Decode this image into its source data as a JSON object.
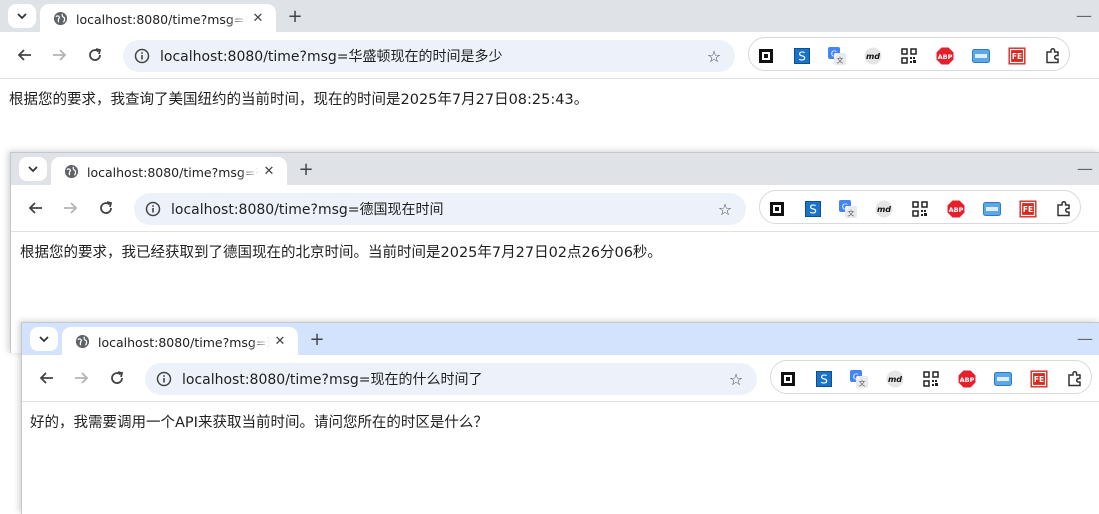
{
  "windows": [
    {
      "tab": {
        "title": "localhost:8080/time?msg=华盛顿现在的时间是多少"
      },
      "omnibox": {
        "host": "localhost",
        "rest": ":8080/time?msg=华盛顿现在的时间是多少"
      },
      "content": "根据您的要求，我查询了美国纽约的当前时间，现在的时间是2025年7月27日08:25:43。"
    },
    {
      "tab": {
        "title": "localhost:8080/time?msg=德国现在时间"
      },
      "omnibox": {
        "host": "localhost",
        "rest": ":8080/time?msg=德国现在时间"
      },
      "content": "根据您的要求，我已经获取到了德国现在的北京时间。当前时间是2025年7月27日02点26分06秒。"
    },
    {
      "tab": {
        "title": "localhost:8080/time?msg=现在的什么时间了"
      },
      "omnibox": {
        "host": "localhost",
        "rest": ":8080/time?msg=现在的什么时间了"
      },
      "content": "好的，我需要调用一个API来获取当前时间。请问您所在的时区是什么？"
    }
  ],
  "extensions": [
    "qr-block-icon",
    "s-extension-icon",
    "google-translate-icon",
    "md-icon",
    "qr-code-icon",
    "adblock-plus-icon",
    "card-icon",
    "fe-icon",
    "puzzle-extensions-icon"
  ],
  "glyphs": {
    "abp": "ABP",
    "md": "md",
    "fe": "FE",
    "s": "S",
    "translate": "G"
  }
}
